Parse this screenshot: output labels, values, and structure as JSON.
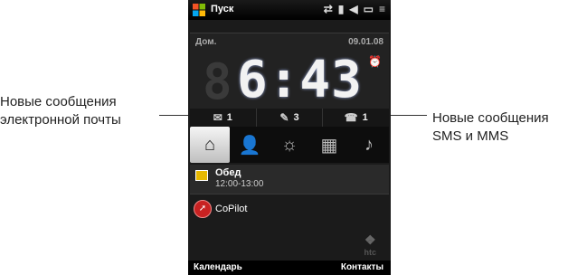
{
  "annotations": {
    "left": [
      "Новые сообщения",
      "электронной почты"
    ],
    "right": [
      "Новые сообщения",
      "SMS и MMS"
    ]
  },
  "statusbar": {
    "title": "Пуск",
    "icons": [
      "sync-icon",
      "signal-icon",
      "volume-icon",
      "battery-icon",
      "menu-icon"
    ]
  },
  "clock_panel": {
    "home_label": "Дом.",
    "date": "09.01.08",
    "time": "6:43"
  },
  "notifications": {
    "email_count": "1",
    "sms_count": "3",
    "missed_calls_count": "1"
  },
  "tabs": [
    "home-icon",
    "people-icon",
    "weather-icon",
    "apps-icon",
    "music-phone-icon"
  ],
  "agenda": {
    "title": "Обед",
    "time": "12:00-13:00"
  },
  "app": {
    "label": "CoPilot"
  },
  "brand": {
    "text": "htc"
  },
  "softkeys": {
    "left": "Календарь",
    "right": "Контакты"
  },
  "colors": {
    "screen_bg": "#1b1b1b",
    "copilot_red": "#c82222",
    "calendar_yellow": "#e6b800"
  }
}
